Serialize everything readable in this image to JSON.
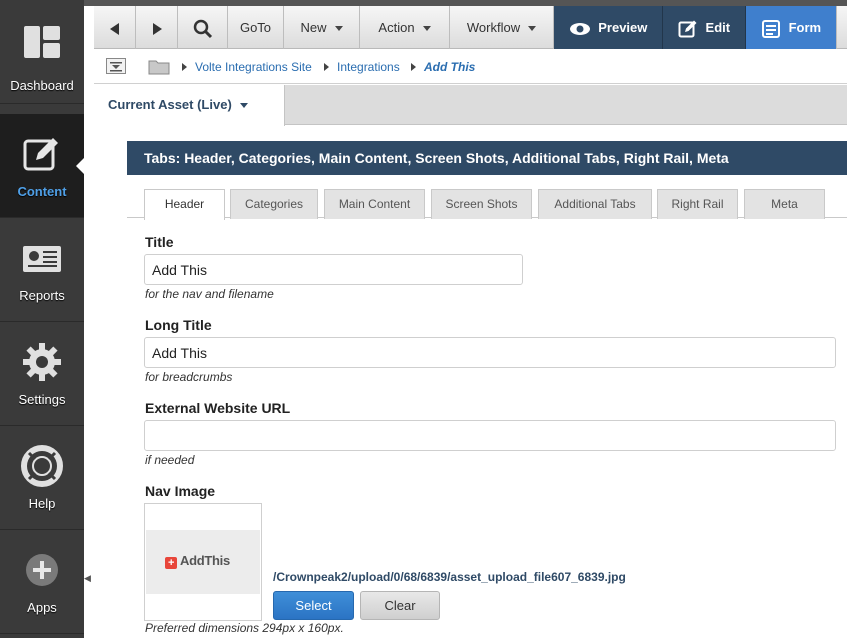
{
  "sidebar": {
    "items": [
      {
        "label": "Dashboard",
        "icon": "dashboard-icon"
      },
      {
        "label": "Content",
        "icon": "edit-icon",
        "active": true
      },
      {
        "label": "Reports",
        "icon": "reports-icon"
      },
      {
        "label": "Settings",
        "icon": "gear-icon"
      },
      {
        "label": "Help",
        "icon": "lifebuoy-icon"
      },
      {
        "label": "Apps",
        "icon": "plus-circle-icon"
      }
    ]
  },
  "toolbar": {
    "back_icon": "back-arrow-icon",
    "forward_icon": "forward-arrow-icon",
    "search_icon": "search-icon",
    "goto_label": "GoTo",
    "new_label": "New",
    "action_label": "Action",
    "workflow_label": "Workflow",
    "preview_label": "Preview",
    "edit_label": "Edit",
    "form_label": "Form"
  },
  "breadcrumb": {
    "items": [
      "Volte Integrations Site",
      "Integrations"
    ],
    "current": "Add This"
  },
  "asset_selector": {
    "label": "Current Asset (Live)"
  },
  "panel": {
    "title": "Tabs: Header, Categories, Main Content, Screen Shots, Additional Tabs, Right Rail, Meta",
    "tabs": [
      "Header",
      "Categories",
      "Main Content",
      "Screen Shots",
      "Additional Tabs",
      "Right Rail",
      "Meta"
    ],
    "active_tab": "Header"
  },
  "form": {
    "title": {
      "label": "Title",
      "value": "Add This",
      "hint": "for the nav and filename"
    },
    "long_title": {
      "label": "Long Title",
      "value": "Add This",
      "hint": "for breadcrumbs"
    },
    "external_url": {
      "label": "External Website URL",
      "value": "",
      "hint": "if needed"
    },
    "nav_image": {
      "label": "Nav Image",
      "logo_text": "AddThis",
      "path": "/Crownpeak2/upload/0/68/6839/asset_upload_file607_6839.jpg",
      "select_label": "Select",
      "clear_label": "Clear",
      "hint": "Preferred dimensions 294px x 160px."
    }
  },
  "colors": {
    "nav_dark": "#2f4a66",
    "accent_blue": "#3f7fcd",
    "link_blue": "#2a6db0",
    "sidebar_bg": "#3a3a3a"
  }
}
